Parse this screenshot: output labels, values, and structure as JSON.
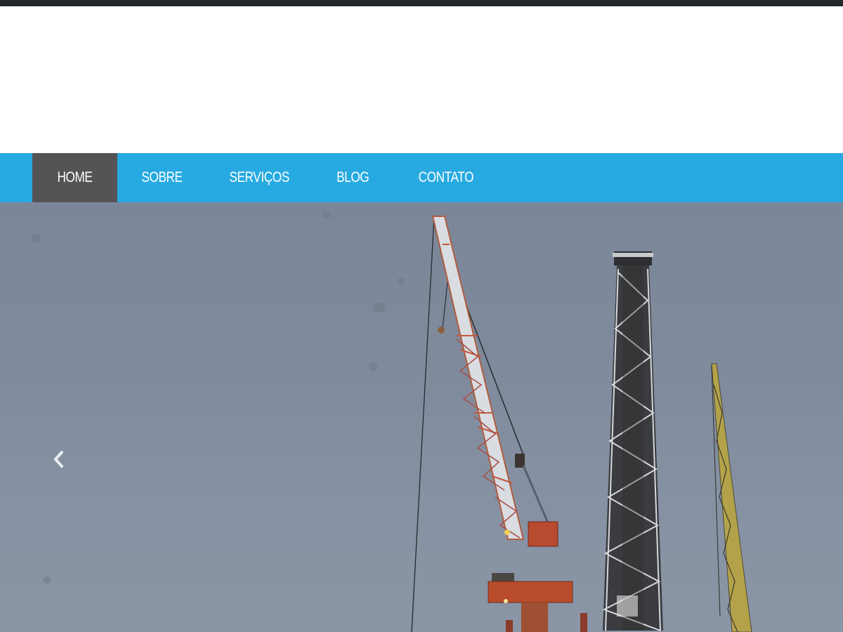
{
  "nav": {
    "items": [
      {
        "label": "HOME",
        "active": true
      },
      {
        "label": "SOBRE",
        "active": false
      },
      {
        "label": "SERVIÇOS",
        "active": false
      },
      {
        "label": "BLOG",
        "active": false
      },
      {
        "label": "CONTATO",
        "active": false
      }
    ]
  },
  "slider": {
    "prev_icon": "chevron-left-icon",
    "image": "offshore-drilling-rig-cranes"
  },
  "colors": {
    "topbar": "#23282d",
    "nav_background": "#27aae1",
    "nav_active": "#555355",
    "nav_text": "#ffffff"
  }
}
